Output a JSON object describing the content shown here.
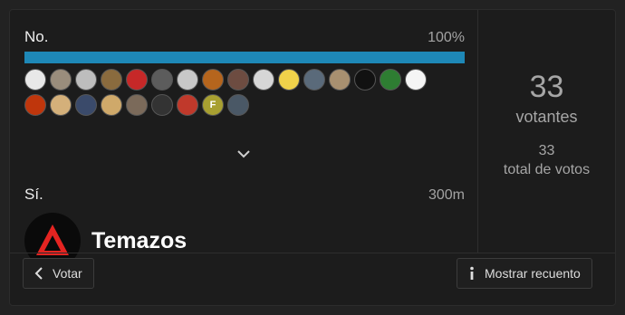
{
  "poll": {
    "options": [
      {
        "label": "No.",
        "percent_text": "100%",
        "percent": 100
      },
      {
        "label": "Sí.",
        "link_text": "300m",
        "embed_title": "Temazos"
      }
    ],
    "voters": [
      {
        "color": "#e8e8e8",
        "icon": "clock-avatar"
      },
      {
        "color": "#9a8d7c",
        "icon": "person-avatar"
      },
      {
        "color": "#bdbdbd",
        "icon": "sketch-avatar"
      },
      {
        "color": "#8a6b3e",
        "icon": "animal-avatar"
      },
      {
        "color": "#c62828",
        "icon": "red-figure-avatar"
      },
      {
        "color": "#5c5c5c",
        "icon": "dark-figure-avatar"
      },
      {
        "color": "#c8c8c8",
        "icon": "eye-avatar"
      },
      {
        "color": "#b5651d",
        "icon": "guitar-avatar"
      },
      {
        "color": "#6d4c41",
        "icon": "cat-avatar"
      },
      {
        "color": "#d6d6d6",
        "icon": "rabbit-avatar"
      },
      {
        "color": "#f0d24a",
        "icon": "cartoon-avatar"
      },
      {
        "color": "#5a6a7a",
        "icon": "badge-avatar"
      },
      {
        "color": "#a89070",
        "icon": "portrait-avatar"
      },
      {
        "color": "#111111",
        "icon": "skull-avatar"
      },
      {
        "color": "#2e7d32",
        "icon": "green-avatar"
      },
      {
        "color": "#f5f5f5",
        "icon": "phone-avatar"
      },
      {
        "color": "#bf360c",
        "icon": "sunset-avatar"
      },
      {
        "color": "#d4b07a",
        "icon": "owl-avatar"
      },
      {
        "color": "#3a4a6a",
        "icon": "blue-avatar"
      },
      {
        "color": "#cfa96a",
        "icon": "dog-avatar"
      },
      {
        "color": "#7b6a5a",
        "icon": "monkey-avatar"
      },
      {
        "color": "#333333",
        "icon": "emblem-avatar"
      },
      {
        "color": "#c0392b",
        "icon": "cowboy-avatar"
      },
      {
        "color": "#a8a031",
        "icon": "letter-avatar",
        "letter": "F"
      },
      {
        "color": "#4a5866",
        "icon": "car-avatar"
      }
    ],
    "stats": {
      "voters_count": "33",
      "voters_label": "votantes",
      "votes_count": "33",
      "votes_label": "total de votos"
    },
    "buttons": {
      "vote_label": "Votar",
      "count_label": "Mostrar recuento"
    }
  }
}
